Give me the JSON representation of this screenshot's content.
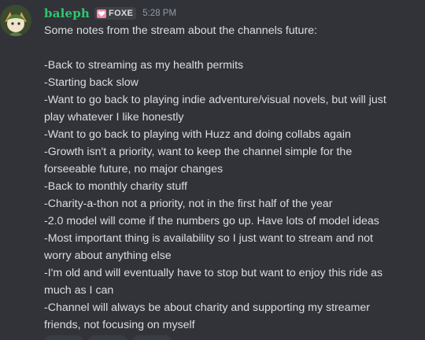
{
  "message": {
    "author": "baleph",
    "tag": {
      "label": "FOXE",
      "icon": "heart-icon",
      "icon_color": "#ff8fb1"
    },
    "timestamp": "5:28 PM",
    "lines": [
      "Some notes from the stream about the channels future:",
      "",
      "-Back to streaming as my health permits",
      "-Starting back slow",
      "-Want to go back to playing indie adventure/visual novels, but will just",
      "play whatever I like honestly",
      "-Want to go back to playing with Huzz and doing collabs again",
      "-Growth isn't a priority, want to keep the channel simple for the",
      "forseeable future, no major changes",
      "-Back to monthly charity stuff",
      "-Charity-a-thon not a priority, not in the first half of the year",
      "-2.0 model will come if the numbers go up. Have lots of model ideas",
      "-Most important thing is availability so I just want to stream and not",
      "worry about anything else",
      "-I'm old and will eventually have to stop but want to enjoy this ride as",
      "much as I can",
      "-Channel will always be about charity and supporting my streamer",
      "friends, not focusing on myself"
    ]
  },
  "colors": {
    "background": "#313338",
    "username": "#2dc770",
    "text": "#dbdee1",
    "timestamp": "#949ba4"
  }
}
